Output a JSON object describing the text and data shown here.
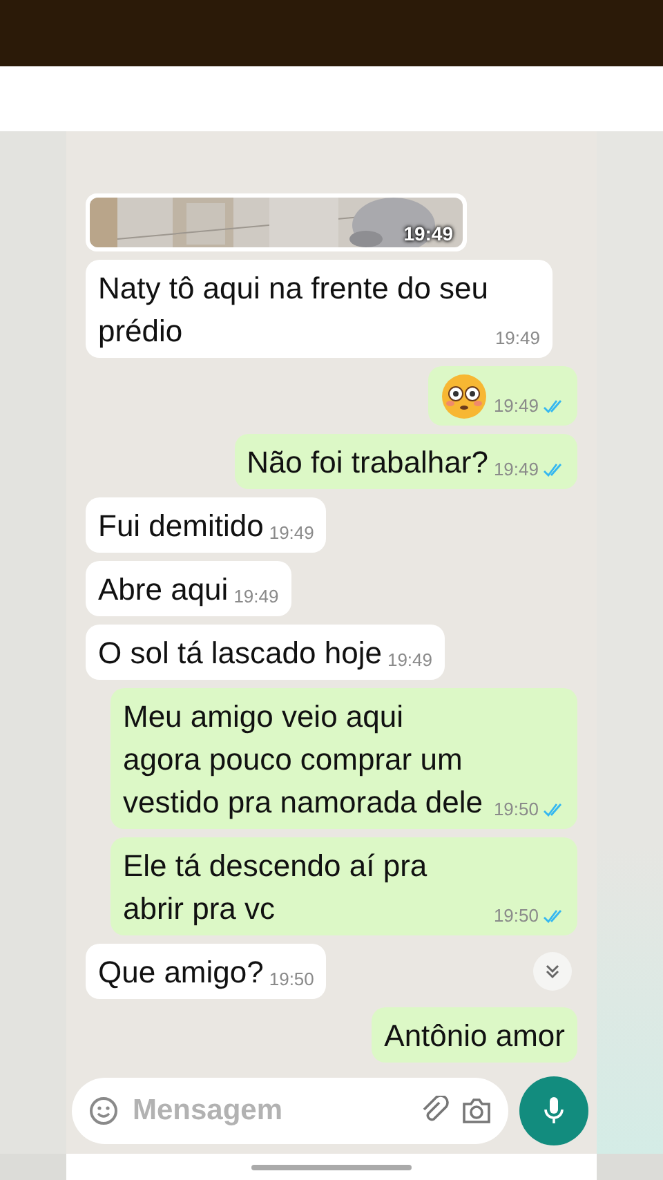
{
  "messages": [
    {
      "outgoing": false,
      "time": "19:49"
    },
    {
      "kind": "text",
      "outgoing": false,
      "text": "Naty tô aqui na frente do seu prédio",
      "time": "19:49"
    },
    {
      "kind": "emoji",
      "outgoing": true,
      "time": "19:49",
      "read": true
    },
    {
      "kind": "text",
      "outgoing": true,
      "text": "Não foi trabalhar?",
      "time": "19:49",
      "read": true
    },
    {
      "kind": "text",
      "outgoing": false,
      "text": "Fui demitido",
      "time": "19:49"
    },
    {
      "kind": "text",
      "outgoing": false,
      "text": "Abre aqui",
      "time": "19:49"
    },
    {
      "kind": "text",
      "outgoing": false,
      "text": "O sol tá lascado hoje",
      "time": "19:49"
    },
    {
      "kind": "text",
      "outgoing": true,
      "text": "Meu amigo veio aqui agora pouco comprar um vestido pra namorada dele",
      "time": "19:50",
      "read": true
    },
    {
      "kind": "text",
      "outgoing": true,
      "text": "Ele tá descendo aí pra abrir pra vc",
      "time": "19:50",
      "read": true
    },
    {
      "kind": "text",
      "outgoing": false,
      "text": "Que amigo?",
      "time": "19:50"
    },
    {
      "kind": "text",
      "outgoing": true,
      "text": "Antônio amor"
    }
  ],
  "composer": {
    "placeholder": "Mensagem"
  }
}
